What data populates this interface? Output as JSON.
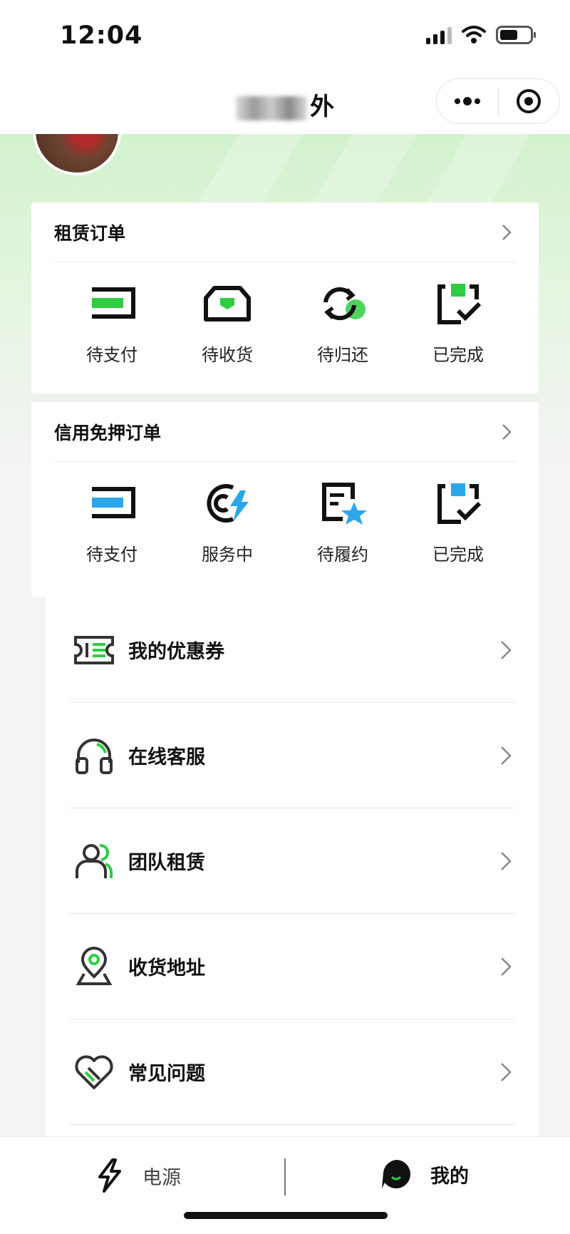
{
  "status_bar": {
    "time": "12:04"
  },
  "nav": {
    "title_suffix": "外"
  },
  "rental_orders": {
    "title": "租赁订单",
    "items": [
      {
        "label": "待支付",
        "icon": "wallet-icon"
      },
      {
        "label": "待收货",
        "icon": "box-icon"
      },
      {
        "label": "待归还",
        "icon": "return-icon"
      },
      {
        "label": "已完成",
        "icon": "done-icon"
      }
    ]
  },
  "credit_orders": {
    "title": "信用免押订单",
    "items": [
      {
        "label": "待支付",
        "icon": "wallet-icon"
      },
      {
        "label": "服务中",
        "icon": "service-icon"
      },
      {
        "label": "待履约",
        "icon": "contract-icon"
      },
      {
        "label": "已完成",
        "icon": "done-icon"
      }
    ]
  },
  "menu": [
    {
      "label": "我的优惠券",
      "icon": "coupon-icon"
    },
    {
      "label": "在线客服",
      "icon": "headset-icon"
    },
    {
      "label": "团队租赁",
      "icon": "team-icon"
    },
    {
      "label": "收货地址",
      "icon": "location-icon"
    },
    {
      "label": "常见问题",
      "icon": "heart-question-icon"
    }
  ],
  "tabs": [
    {
      "label": "电源",
      "icon": "lightning-icon"
    },
    {
      "label": "我的",
      "icon": "profile-icon",
      "active": true
    }
  ],
  "colors": {
    "accent": "#2ecc40",
    "accent_light": "#9be36a",
    "blue_accent": "#2aa7e8"
  }
}
